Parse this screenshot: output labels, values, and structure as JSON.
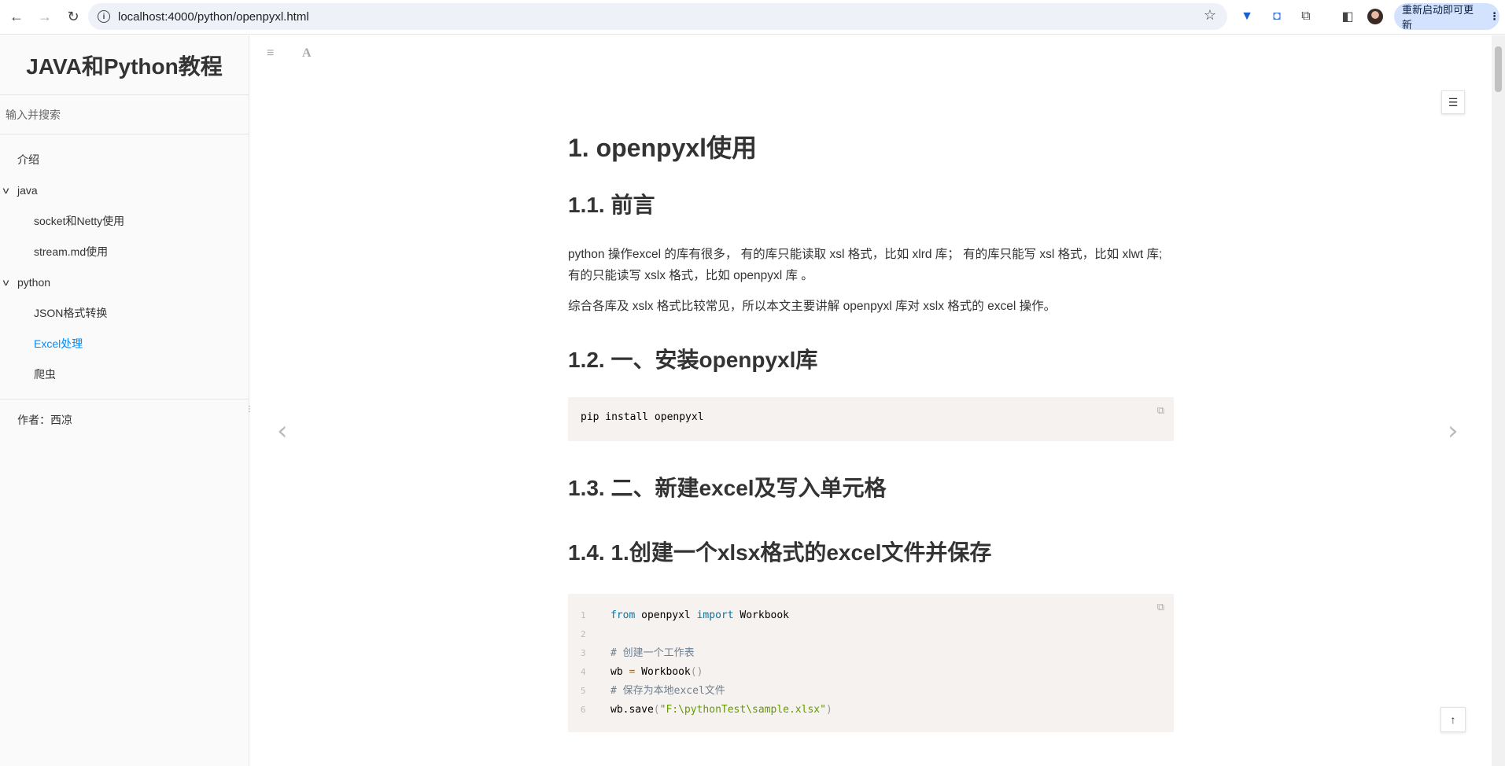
{
  "browser": {
    "url": "localhost:4000/python/openpyxl.html",
    "restart_label": "重新启动即可更新",
    "back_icon": "arrow-left",
    "forward_icon": "arrow-right",
    "reload_icon": "reload"
  },
  "sidebar": {
    "book_title": "JAVA和Python教程",
    "search_placeholder": "输入并搜索",
    "items": [
      {
        "label": "介绍"
      },
      {
        "label": "java"
      },
      {
        "label": "socket和Netty使用"
      },
      {
        "label": "stream.md使用"
      },
      {
        "label": "python"
      },
      {
        "label": "JSON格式转换"
      },
      {
        "label": "Excel处理"
      },
      {
        "label": "爬虫"
      }
    ],
    "author": "作者：西凉",
    "active_color": "#008cff"
  },
  "article": {
    "h1": "1. openpyxl使用",
    "h2_intro": "1.1. 前言",
    "p1": "python 操作excel 的库有很多， 有的库只能读取 xsl 格式，比如 xlrd 库； 有的库只能写 xsl 格式，比如 xlwt 库; 有的只能读写 xslx 格式，比如 openpyxl 库 。",
    "p2": "综合各库及 xslx 格式比较常见，所以本文主要讲解 openpyxl 库对 xslx 格式的 excel 操作。",
    "h2_install": "1.2. 一、安装openpyxl库",
    "install_cmd": "pip install openpyxl",
    "h2_new": "1.3. 二、新建excel及写入单元格",
    "h2_create": "1.4. 1.创建一个xlsx格式的excel文件并保存",
    "code": {
      "l1_from": "from",
      "l1_mod": " openpyxl ",
      "l1_import": "import",
      "l1_name": " Workbook",
      "l3": "# 创建一个工作表",
      "l4_a": "wb ",
      "l4_eq": "=",
      "l4_b": " Workbook",
      "l4_paren": "()",
      "l5": "# 保存为本地excel文件",
      "l6_a": "wb.save",
      "l6_open": "(",
      "l6_str": "\"F:\\pythonTest\\sample.xlsx\"",
      "l6_close": ")"
    },
    "line_numbers": [
      "1",
      "2",
      "3",
      "4",
      "5",
      "6"
    ]
  }
}
